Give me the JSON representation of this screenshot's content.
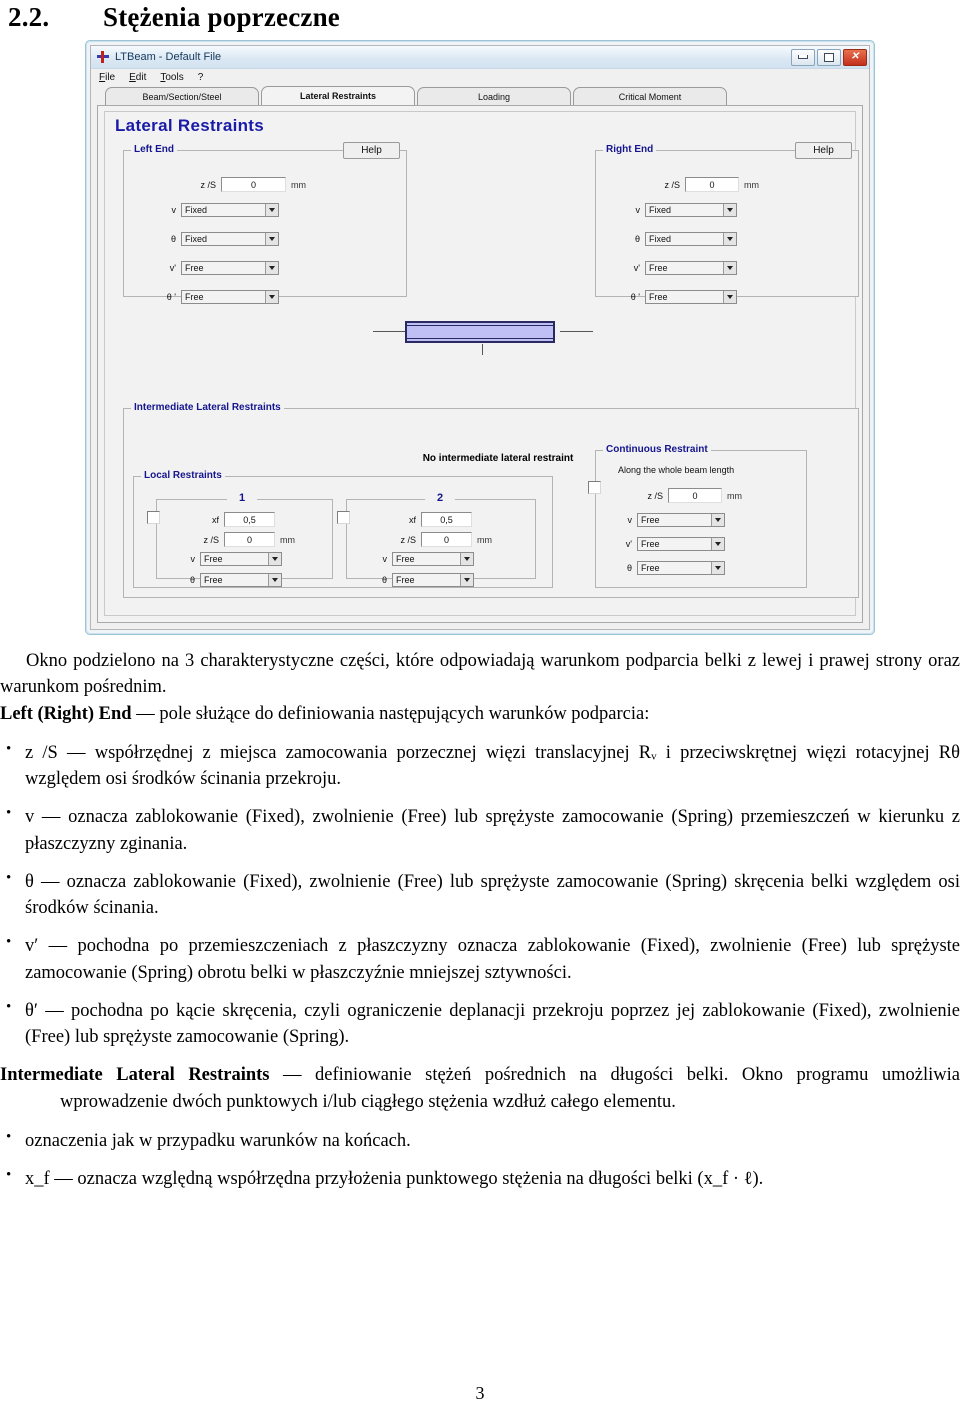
{
  "document": {
    "section_number": "2.2.",
    "section_title": "Stężenia poprzeczne",
    "page_number": "3"
  },
  "screenshot": {
    "window": {
      "app_icon": "ltbeam-logo-icon",
      "title": "LTBeam - Default File",
      "buttons": {
        "minimize": "minimize-icon",
        "maximize": "maximize-icon",
        "close": "✕"
      }
    },
    "menu": [
      {
        "prefix": "F",
        "rest": "ile"
      },
      {
        "prefix": "E",
        "rest": "dit"
      },
      {
        "prefix": "T",
        "rest": "ools"
      },
      {
        "prefix": "?",
        "rest": ""
      }
    ],
    "tabs": [
      {
        "label": "Beam/Section/Steel",
        "active": false
      },
      {
        "label": "Lateral Restraints",
        "active": true
      },
      {
        "label": "Loading",
        "active": false
      },
      {
        "label": "Critical Moment",
        "active": false
      }
    ],
    "pane_title": "Lateral Restraints",
    "help_label": "Help",
    "left_end": {
      "legend": "Left End",
      "zs_label": "z /S",
      "zs_value": "0",
      "zs_unit": "mm",
      "fields": [
        {
          "label": "v",
          "value": "Fixed"
        },
        {
          "label": "θ",
          "value": "Fixed"
        },
        {
          "label": "v'",
          "value": "Free"
        },
        {
          "label": "θ '",
          "value": "Free"
        }
      ]
    },
    "right_end": {
      "legend": "Right End",
      "zs_label": "z /S",
      "zs_value": "0",
      "zs_unit": "mm",
      "fields": [
        {
          "label": "v",
          "value": "Fixed"
        },
        {
          "label": "θ",
          "value": "Fixed"
        },
        {
          "label": "v'",
          "value": "Free"
        },
        {
          "label": "θ '",
          "value": "Free"
        }
      ]
    },
    "intermediate": {
      "legend": "Intermediate Lateral Restraints",
      "status": "No intermediate lateral restraint",
      "local": {
        "legend": "Local Restraints",
        "groups": [
          {
            "number": "1",
            "checked": false,
            "xf_label": "xf",
            "xf_value": "0,5",
            "zs_label": "z /S",
            "zs_value": "0",
            "zs_unit": "mm",
            "fields": [
              {
                "label": "v",
                "value": "Free"
              },
              {
                "label": "θ",
                "value": "Free"
              }
            ]
          },
          {
            "number": "2",
            "checked": false,
            "xf_label": "xf",
            "xf_value": "0,5",
            "zs_label": "z /S",
            "zs_value": "0",
            "zs_unit": "mm",
            "fields": [
              {
                "label": "v",
                "value": "Free"
              },
              {
                "label": "θ",
                "value": "Free"
              }
            ]
          }
        ]
      },
      "continuous": {
        "legend": "Continuous Restraint",
        "caption": "Along the whole beam length",
        "checked": false,
        "zs_label": "z /S",
        "zs_value": "0",
        "zs_unit": "mm",
        "fields": [
          {
            "label": "v",
            "value": "Free"
          },
          {
            "label": "v'",
            "value": "Free"
          },
          {
            "label": "θ",
            "value": "Free"
          }
        ]
      }
    },
    "colors": {
      "beam_fill": "#bfbff5",
      "beam_border": "#2a2a62",
      "heading_blue": "#1a1aa8",
      "legend_blue": "#15158f",
      "close_red": "#c3301b"
    }
  },
  "text": {
    "intro": "Okno podzielono na 3 charakterystyczne części, które odpowiadają warunkom podparcia belki z lewej i prawej strony oraz warunkom pośrednim.",
    "left_right_term": "Left (Right) End",
    "left_right_def": "— pole służące do definiowania następujących warunków podparcia:",
    "bullets_ends": [
      "z /S — współrzędnej z miejsca zamocowania porzecznej więzi translacyjnej Rᵥ i przeciwskrętnej więzi rotacyjnej Rθ względem osi środków ścinania przekroju.",
      "v — oznacza zablokowanie (Fixed), zwolnienie (Free) lub sprężyste zamocowanie (Spring) przemieszczeń w kierunku z płaszczyzny zginania.",
      "θ — oznacza zablokowanie (Fixed), zwolnienie (Free) lub sprężyste zamocowanie (Spring) skręcenia belki względem osi środków ścinania.",
      "v′ — pochodna po przemieszczeniach z płaszczyzny oznacza zablokowanie (Fixed), zwolnienie (Free) lub sprężyste zamocowanie (Spring) obrotu belki w płaszczyźnie mniejszej sztywności.",
      "θ′ — pochodna po kącie skręcenia, czyli ograniczenie deplanacji przekroju poprzez jej zablokowanie (Fixed), zwolnienie (Free) lub sprężyste zamocowanie (Spring)."
    ],
    "intermediate_term": "Intermediate Lateral Restraints",
    "intermediate_def": "— definiowanie stężeń pośrednich na długości belki. Okno programu umożliwia wprowadzenie dwóch punktowych i/lub ciągłego stężenia wzdłuż całego elementu.",
    "bullets_intermediate": [
      "oznaczenia jak w przypadku warunków na końcach.",
      "x_f — oznacza względną współrzędna przyłożenia punktowego stężenia na długości belki (x_f · ℓ)."
    ]
  }
}
